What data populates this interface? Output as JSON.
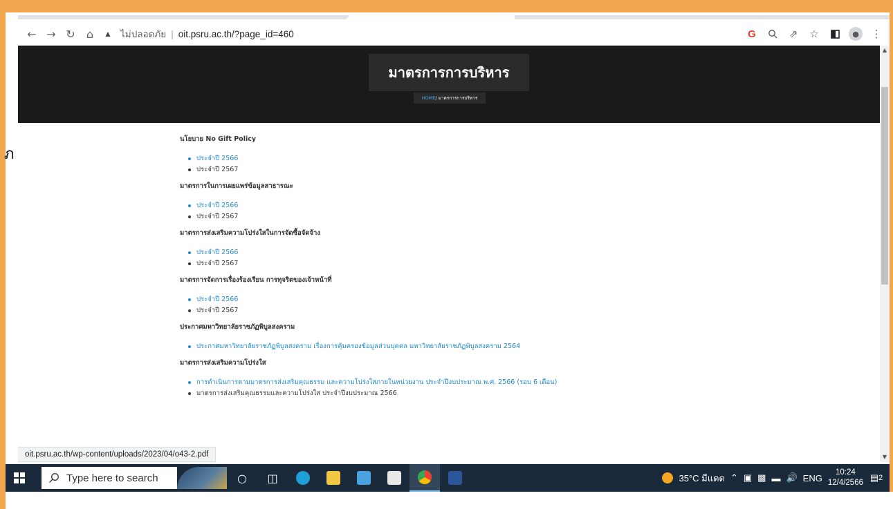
{
  "browser": {
    "security_label": "ไม่ปลอดภัย",
    "url": "oit.psru.ac.th/?page_id=460",
    "status_url": "oit.psru.ac.th/wp-content/uploads/2023/04/o43-2.pdf"
  },
  "hero": {
    "title": "มาตรการการบริหาร",
    "breadcrumb_home": "HOME",
    "breadcrumb_current": "/ มาตรการการบริหาร"
  },
  "stray_char": "ภ",
  "sections": [
    {
      "heading": "นโยบาย No Gift Policy",
      "items": [
        {
          "label": "ประจำปี 2566",
          "link": true
        },
        {
          "label": "ประจำปี 2567",
          "link": false
        }
      ]
    },
    {
      "heading": "มาตรการในการเผยแพร่ข้อมูลสาธารณะ",
      "items": [
        {
          "label": "ประจำปี 2566",
          "link": true
        },
        {
          "label": "ประจำปี 2567",
          "link": false
        }
      ]
    },
    {
      "heading": "มาตรการส่งเสริมความโปร่งใสในการจัดซื้อจัดจ้าง",
      "items": [
        {
          "label": "ประจำปี 2566",
          "link": true
        },
        {
          "label": "ประจำปี 2567",
          "link": false
        }
      ]
    },
    {
      "heading": "มาตรการจัดการเรื่องร้องเรียน การทุจริตของเจ้าหน้าที่",
      "items": [
        {
          "label": "ประจำปี 2566",
          "link": true
        },
        {
          "label": "ประจำปี 2567",
          "link": false
        }
      ]
    },
    {
      "heading": "ประกาศมหาวิทยาลัยราชภัฏพิบูลสงคราม",
      "items": [
        {
          "label": "ประกาศมหาวิทยาลัยราชภัฏพิบูลสงคราม เรื่องการคุ้มครองข้อมูลส่วนบุคคล มหาวิทยาลัยราชภัฏพิบูลสงคราม 2564",
          "link": true
        }
      ]
    },
    {
      "heading": "มาตรการส่งเสริมความโปร่งใส",
      "items": [
        {
          "label": "การดำเนินการตามมาตรการส่งเสริมคุณธรรม และความโปร่งใสภายในหน่วยงาน ประจำปีงบประมาณ พ.ศ. 2566 (รอบ 6 เดือน)",
          "link": true
        },
        {
          "label": "มาตรการส่งเสริมคุณธรรมและความโปร่งใส ประจำปีงบประมาณ 2566",
          "link": false
        }
      ]
    }
  ],
  "taskbar": {
    "search_placeholder": "Type here to search",
    "weather": "35°C มีแดด",
    "language": "ENG",
    "time": "10:24",
    "date": "12/4/2566",
    "notification_count": "2"
  },
  "colors": {
    "frame_border": "#f2a74f",
    "hero_bg": "#1a1a1a",
    "link": "#1e88c8",
    "taskbar_bg": "#1b2a3a"
  }
}
